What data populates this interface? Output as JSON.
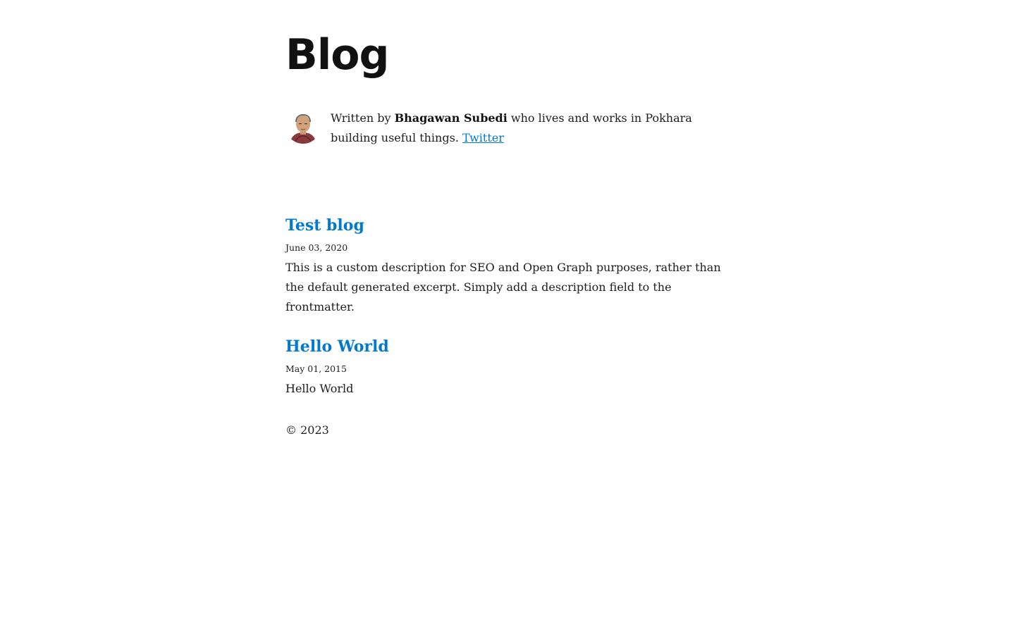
{
  "header": {
    "title": "Blog"
  },
  "bio": {
    "prefix": "Written by ",
    "author": "Bhagawan Subedi",
    "suffix": " who lives and works in Pokhara building useful things. ",
    "link_label": "Twitter"
  },
  "posts": [
    {
      "title": "Test blog",
      "date": "June 03, 2020",
      "excerpt": "This is a custom description for SEO and Open Graph purposes, rather than the default generated excerpt. Simply add a description field to the frontmatter."
    },
    {
      "title": "Hello World",
      "date": "May 01, 2015",
      "excerpt": "Hello World"
    }
  ],
  "footer": {
    "copyright": "© 2023"
  },
  "colors": {
    "link": "#007acc",
    "text": "#1d1d1d",
    "heading": "#111111"
  }
}
